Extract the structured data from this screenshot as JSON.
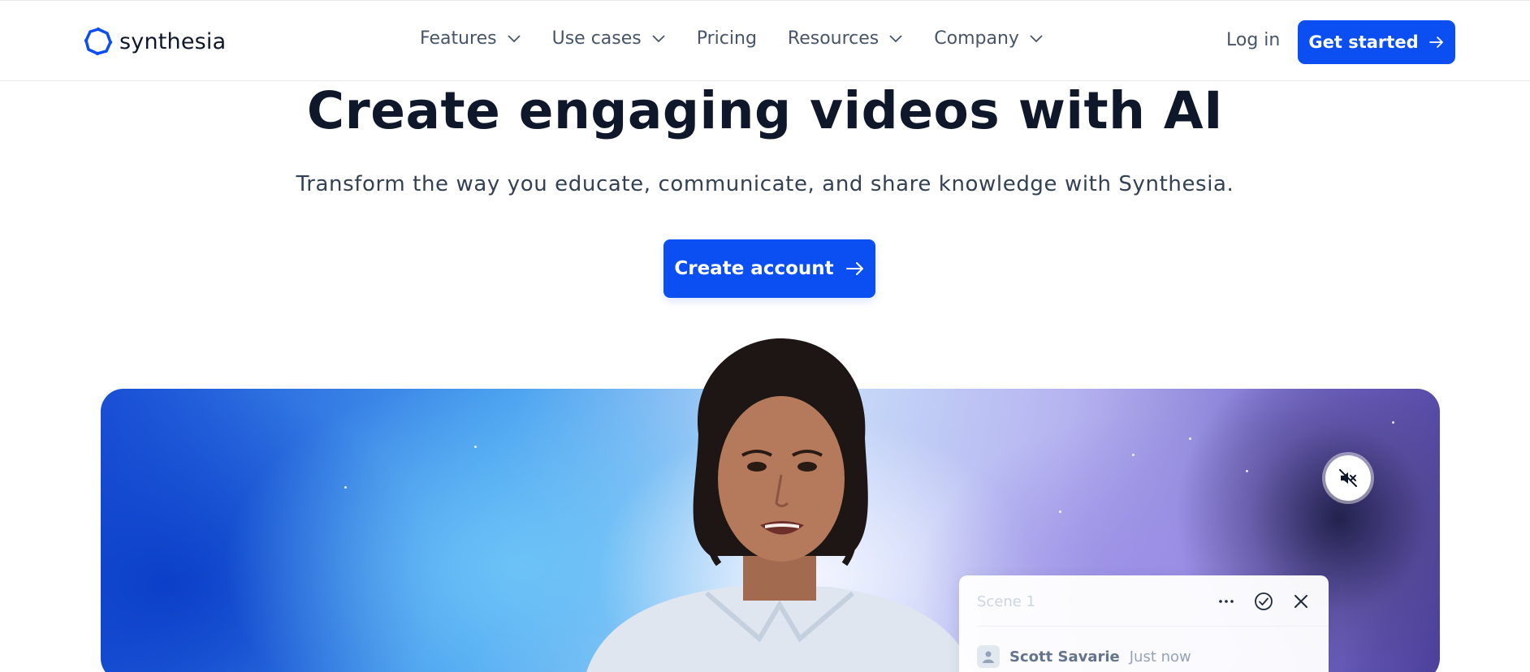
{
  "brand": {
    "name": "synthesia",
    "accent_color": "#0b4ff2"
  },
  "nav": {
    "items": [
      {
        "label": "Features",
        "has_dropdown": true,
        "icon": "chevron-down-icon"
      },
      {
        "label": "Use cases",
        "has_dropdown": true,
        "icon": "chevron-down-icon"
      },
      {
        "label": "Pricing",
        "has_dropdown": false
      },
      {
        "label": "Resources",
        "has_dropdown": true,
        "icon": "chevron-down-icon"
      },
      {
        "label": "Company",
        "has_dropdown": true,
        "icon": "chevron-down-icon"
      }
    ],
    "login_label": "Log in",
    "get_started_label": "Get started"
  },
  "hero": {
    "title": "Create engaging videos with AI",
    "subtitle": "Transform the way you educate, communicate, and share knowledge with Synthesia.",
    "cta_label": "Create account"
  },
  "video": {
    "mute_icon": "speaker-muted-icon",
    "scene_card": {
      "scene_label": "Scene 1",
      "actions": [
        "more-options-icon",
        "check-circle-icon",
        "close-icon"
      ],
      "comment": {
        "author": "Scott Savarie",
        "time": "Just now"
      }
    }
  }
}
